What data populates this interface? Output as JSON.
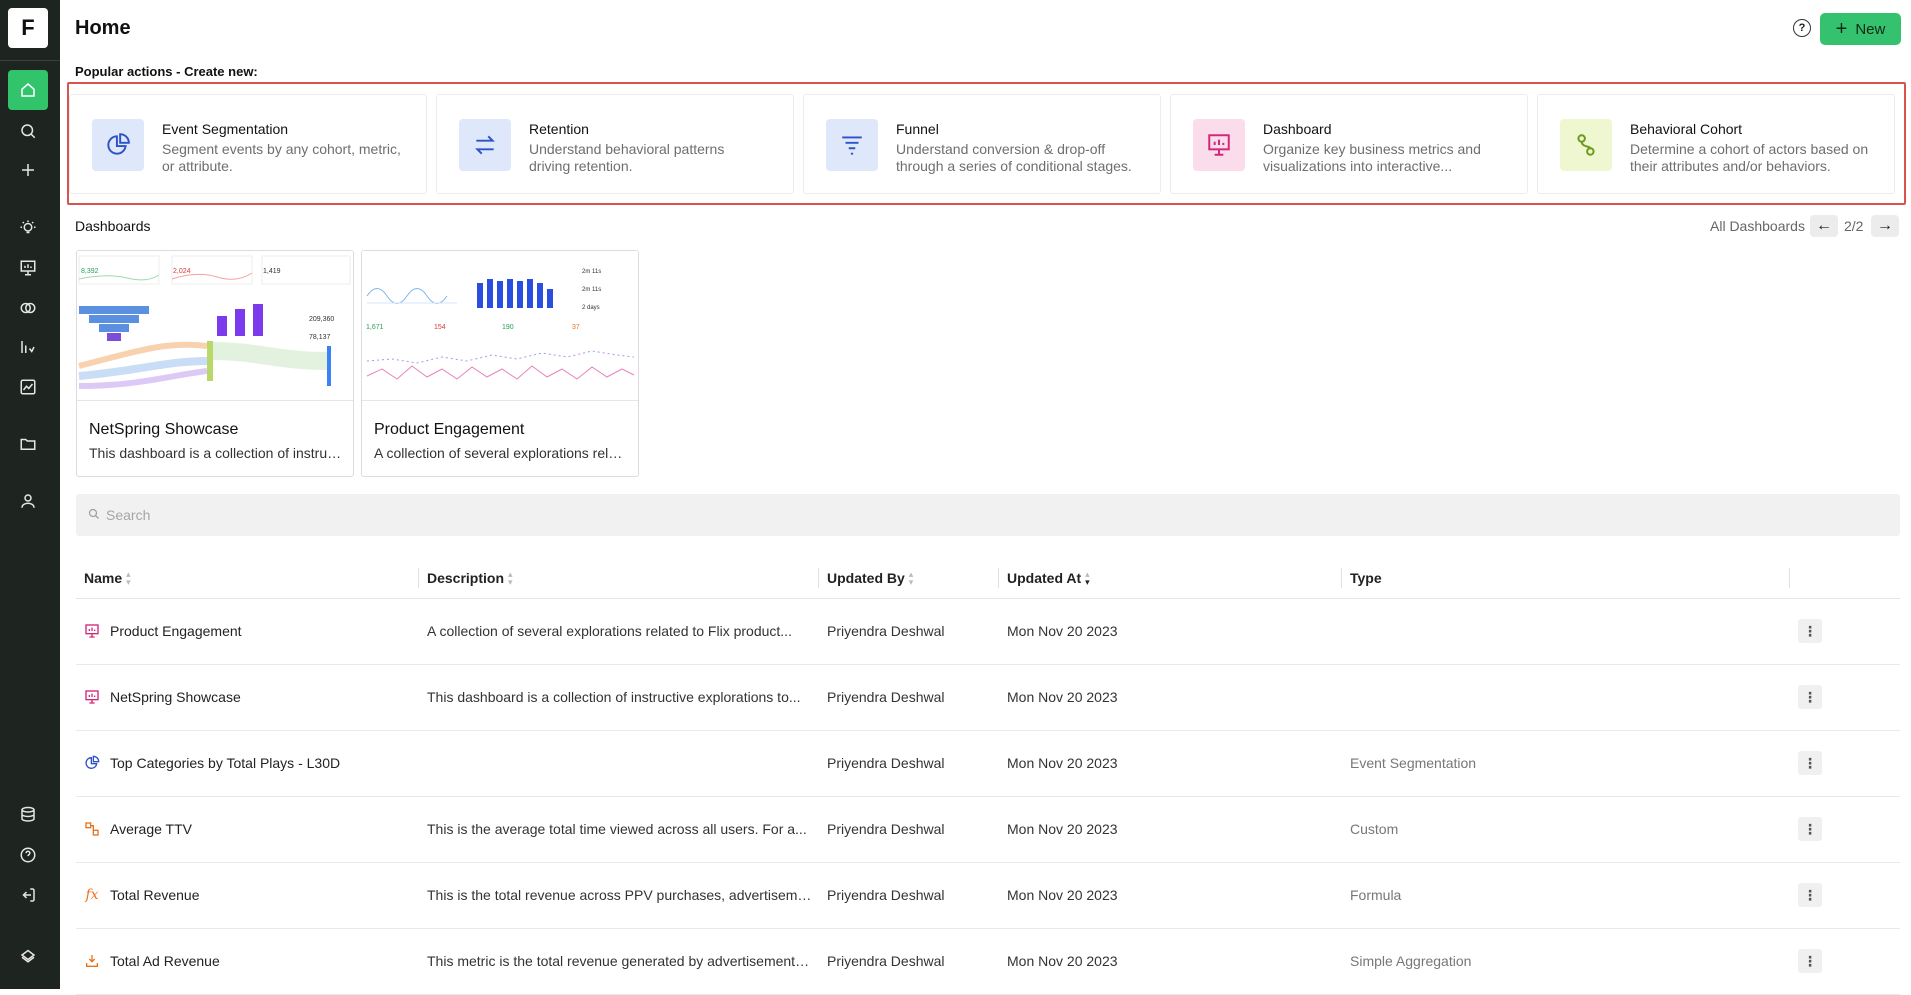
{
  "sidebar": {
    "logo": "F",
    "items": [
      {
        "icon": "home-icon",
        "active": true
      },
      {
        "icon": "search-icon"
      },
      {
        "icon": "plus-icon"
      },
      {
        "icon": "lightbulb-icon"
      },
      {
        "icon": "dashboard-icon"
      },
      {
        "icon": "cohort-icon"
      },
      {
        "icon": "metrics-icon"
      },
      {
        "icon": "chart-icon"
      },
      {
        "icon": "folder-icon"
      },
      {
        "icon": "user-icon"
      },
      {
        "icon": "database-icon"
      },
      {
        "icon": "help-icon"
      },
      {
        "icon": "logout-icon"
      },
      {
        "icon": "brand-icon"
      }
    ]
  },
  "header": {
    "title": "Home",
    "new_label": "New",
    "help_glyph": "?"
  },
  "popular": {
    "label": "Popular actions - Create new:",
    "cards": [
      {
        "title": "Event Segmentation",
        "desc": "Segment events by any cohort, metric, or attribute.",
        "icon": "event-segmentation-icon",
        "bg": "#dfe7fb",
        "fg": "#2b52c9"
      },
      {
        "title": "Retention",
        "desc": "Understand behavioral patterns driving retention.",
        "icon": "retention-icon",
        "bg": "#dfe7fb",
        "fg": "#2b52c9"
      },
      {
        "title": "Funnel",
        "desc": "Understand conversion & drop-off through a series of conditional stages.",
        "icon": "funnel-icon",
        "bg": "#dfe7fb",
        "fg": "#2b52c9"
      },
      {
        "title": "Dashboard",
        "desc": "Organize key business metrics and visualizations into interactive...",
        "icon": "dashboard-icon",
        "bg": "#fbdcea",
        "fg": "#d1267a"
      },
      {
        "title": "Behavioral Cohort",
        "desc": "Determine a cohort of actors based on their attributes and/or behaviors.",
        "icon": "behavioral-cohort-icon",
        "bg": "#eef7cf",
        "fg": "#6c9a1a"
      }
    ]
  },
  "dashboards": {
    "label": "Dashboards",
    "all_label": "All Dashboards",
    "page": "2/2",
    "prev_glyph": "←",
    "next_glyph": "→",
    "thumb_values": {
      "netspring": [
        "8,392",
        "2,024",
        "1,419",
        "209,360",
        "78,137"
      ],
      "product": [
        "2m 11s",
        "2m 11s",
        "2 days",
        "1,671",
        "154",
        "190",
        "37"
      ]
    },
    "cards": [
      {
        "title": "NetSpring Showcase",
        "desc": "This dashboard is a collection of instructive explorations to..."
      },
      {
        "title": "Product Engagement",
        "desc": "A collection of several explorations related to Flix product..."
      }
    ]
  },
  "search": {
    "placeholder": "Search"
  },
  "table": {
    "columns": [
      "Name",
      "Description",
      "Updated By",
      "Updated At",
      "Type"
    ],
    "rows": [
      {
        "name": "Product Engagement",
        "desc": "A collection of several explorations related to Flix product...",
        "by": "Priyendra Deshwal",
        "at": "Mon Nov 20 2023",
        "type": "",
        "icon": "dashboard-icon",
        "color": "#d1267a"
      },
      {
        "name": "NetSpring Showcase",
        "desc": "This dashboard is a collection of instructive explorations to...",
        "by": "Priyendra Deshwal",
        "at": "Mon Nov 20 2023",
        "type": "",
        "icon": "dashboard-icon",
        "color": "#d1267a"
      },
      {
        "name": "Top Categories by Total Plays - L30D",
        "desc": "",
        "by": "Priyendra Deshwal",
        "at": "Mon Nov 20 2023",
        "type": "Event Segmentation",
        "icon": "event-segmentation-icon",
        "color": "#2b52c9"
      },
      {
        "name": "Average TTV",
        "desc": "This is the average total time viewed across all users. For a...",
        "by": "Priyendra Deshwal",
        "at": "Mon Nov 20 2023",
        "type": "Custom",
        "icon": "custom-metric-icon",
        "color": "#e8731d"
      },
      {
        "name": "Total Revenue",
        "desc": "This is the total revenue across PPV purchases, advertisement...",
        "by": "Priyendra Deshwal",
        "at": "Mon Nov 20 2023",
        "type": "Formula",
        "icon": "formula-icon",
        "color": "#e8731d"
      },
      {
        "name": "Total Ad Revenue",
        "desc": "This metric is the total revenue generated by advertisements ...",
        "by": "Priyendra Deshwal",
        "at": "Mon Nov 20 2023",
        "type": "Simple Aggregation",
        "icon": "aggregation-icon",
        "color": "#e8731d"
      }
    ]
  }
}
